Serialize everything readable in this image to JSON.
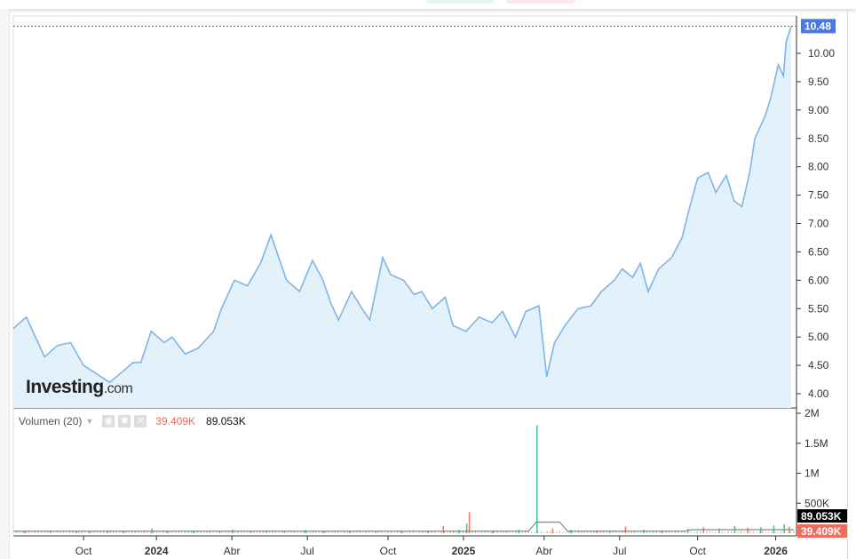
{
  "logo": {
    "text": "Investing",
    "suffix": ".com"
  },
  "volume_legend": {
    "label": "Volumen (20)",
    "value_red": "39.409K",
    "value_black": "89.053K"
  },
  "colors": {
    "line": "#7db5ea",
    "fill": "#e3f1fa",
    "last_price_bg": "#4a78e0",
    "vol_up": "#3ecf8e",
    "vol_down": "#f4786c",
    "vol_black_badge": "#000000",
    "vol_red_badge": "#f26b5f"
  },
  "chart_data": [
    {
      "type": "area",
      "title": "",
      "last_price_label": "10.48",
      "ylim": [
        3.85,
        10.75
      ],
      "y_ticks": [
        "4.00",
        "4.50",
        "5.00",
        "5.50",
        "6.00",
        "6.50",
        "7.00",
        "7.50",
        "8.00",
        "8.50",
        "9.00",
        "9.50",
        "10.00"
      ],
      "x_ticks": [
        {
          "label": "Oct",
          "m": 1.8
        },
        {
          "label": "2024",
          "m": 4.6
        },
        {
          "label": "Abr",
          "m": 7.5
        },
        {
          "label": "Jul",
          "m": 10.4
        },
        {
          "label": "Oct",
          "m": 13.5
        },
        {
          "label": "2025",
          "m": 16.4
        },
        {
          "label": "Abr",
          "m": 19.5
        },
        {
          "label": "Jul",
          "m": 22.4
        },
        {
          "label": "Oct",
          "m": 25.4
        },
        {
          "label": "2026",
          "m": 28.4
        }
      ],
      "x_range_months": [
        -0.9,
        29.2
      ],
      "series": [
        {
          "name": "Price",
          "points": [
            [
              -0.9,
              5.15
            ],
            [
              -0.4,
              5.35
            ],
            [
              -0.1,
              5.05
            ],
            [
              0.3,
              4.65
            ],
            [
              0.8,
              4.85
            ],
            [
              1.3,
              4.9
            ],
            [
              1.8,
              4.5
            ],
            [
              2.3,
              4.35
            ],
            [
              2.8,
              4.2
            ],
            [
              3.2,
              4.35
            ],
            [
              3.7,
              4.55
            ],
            [
              4.0,
              4.55
            ],
            [
              4.4,
              5.1
            ],
            [
              4.9,
              4.9
            ],
            [
              5.2,
              5.0
            ],
            [
              5.7,
              4.7
            ],
            [
              6.2,
              4.8
            ],
            [
              6.8,
              5.1
            ],
            [
              7.1,
              5.5
            ],
            [
              7.6,
              6.0
            ],
            [
              8.1,
              5.9
            ],
            [
              8.6,
              6.3
            ],
            [
              9.0,
              6.8
            ],
            [
              9.3,
              6.4
            ],
            [
              9.6,
              6.0
            ],
            [
              10.1,
              5.8
            ],
            [
              10.6,
              6.35
            ],
            [
              11.0,
              6.0
            ],
            [
              11.3,
              5.6
            ],
            [
              11.6,
              5.3
            ],
            [
              12.1,
              5.8
            ],
            [
              12.5,
              5.5
            ],
            [
              12.8,
              5.3
            ],
            [
              13.3,
              6.4
            ],
            [
              13.6,
              6.1
            ],
            [
              14.1,
              6.0
            ],
            [
              14.5,
              5.75
            ],
            [
              14.8,
              5.8
            ],
            [
              15.2,
              5.5
            ],
            [
              15.7,
              5.7
            ],
            [
              16.0,
              5.2
            ],
            [
              16.5,
              5.1
            ],
            [
              17.0,
              5.35
            ],
            [
              17.5,
              5.25
            ],
            [
              17.9,
              5.45
            ],
            [
              18.4,
              5.0
            ],
            [
              18.8,
              5.45
            ],
            [
              19.3,
              5.55
            ],
            [
              19.6,
              4.3
            ],
            [
              19.9,
              4.9
            ],
            [
              20.3,
              5.2
            ],
            [
              20.8,
              5.5
            ],
            [
              21.3,
              5.55
            ],
            [
              21.7,
              5.8
            ],
            [
              22.2,
              6.0
            ],
            [
              22.5,
              6.2
            ],
            [
              22.9,
              6.05
            ],
            [
              23.2,
              6.3
            ],
            [
              23.5,
              5.8
            ],
            [
              23.9,
              6.2
            ],
            [
              24.4,
              6.4
            ],
            [
              24.8,
              6.75
            ],
            [
              25.1,
              7.3
            ],
            [
              25.4,
              7.8
            ],
            [
              25.8,
              7.9
            ],
            [
              26.1,
              7.55
            ],
            [
              26.5,
              7.85
            ],
            [
              26.8,
              7.4
            ],
            [
              27.1,
              7.3
            ],
            [
              27.4,
              7.9
            ],
            [
              27.6,
              8.5
            ],
            [
              28.0,
              8.9
            ],
            [
              28.2,
              9.2
            ],
            [
              28.5,
              9.8
            ],
            [
              28.7,
              9.6
            ],
            [
              28.8,
              10.2
            ],
            [
              29.0,
              10.48
            ]
          ]
        }
      ]
    },
    {
      "type": "bar",
      "title": "Volumen (20)",
      "ylim": [
        0,
        2000000
      ],
      "y_ticks": [
        {
          "label": "2M",
          "v": 2000000
        },
        {
          "label": "1.5M",
          "v": 1500000
        },
        {
          "label": "1M",
          "v": 1000000
        },
        {
          "label": "500K",
          "v": 500000
        }
      ],
      "series": [
        {
          "name": "Volume",
          "points": [
            [
              -0.5,
              30000,
              0
            ],
            [
              0.5,
              25000,
              1
            ],
            [
              1.5,
              40000,
              0
            ],
            [
              2.0,
              20000,
              1
            ],
            [
              2.7,
              35000,
              1
            ],
            [
              3.3,
              30000,
              0
            ],
            [
              4.4,
              80000,
              1
            ],
            [
              5.0,
              25000,
              0
            ],
            [
              6.0,
              30000,
              1
            ],
            [
              7.0,
              35000,
              0
            ],
            [
              7.5,
              60000,
              1
            ],
            [
              8.2,
              45000,
              0
            ],
            [
              8.8,
              50000,
              1
            ],
            [
              9.5,
              40000,
              0
            ],
            [
              10.3,
              55000,
              1
            ],
            [
              11.0,
              30000,
              0
            ],
            [
              12.0,
              40000,
              1
            ],
            [
              13.0,
              45000,
              0
            ],
            [
              14.0,
              35000,
              1
            ],
            [
              15.0,
              40000,
              0
            ],
            [
              15.6,
              120000,
              0
            ],
            [
              16.2,
              60000,
              1
            ],
            [
              16.6,
              350000,
              0
            ],
            [
              16.5,
              160000,
              1
            ],
            [
              17.5,
              50000,
              0
            ],
            [
              18.5,
              60000,
              1
            ],
            [
              19.2,
              1800000,
              1
            ],
            [
              19.8,
              80000,
              0
            ],
            [
              20.5,
              60000,
              1
            ],
            [
              21.5,
              50000,
              0
            ],
            [
              22.0,
              40000,
              1
            ],
            [
              22.6,
              110000,
              0
            ],
            [
              23.3,
              60000,
              1
            ],
            [
              24.0,
              50000,
              0
            ],
            [
              25.0,
              70000,
              1
            ],
            [
              25.6,
              100000,
              0
            ],
            [
              26.2,
              80000,
              1
            ],
            [
              26.8,
              120000,
              1
            ],
            [
              27.3,
              90000,
              0
            ],
            [
              27.8,
              100000,
              1
            ],
            [
              28.3,
              130000,
              1
            ],
            [
              28.7,
              150000,
              1
            ],
            [
              28.9,
              110000,
              0
            ]
          ]
        }
      ],
      "ma_value": "89.053K",
      "last_volume": "39.409K"
    }
  ]
}
